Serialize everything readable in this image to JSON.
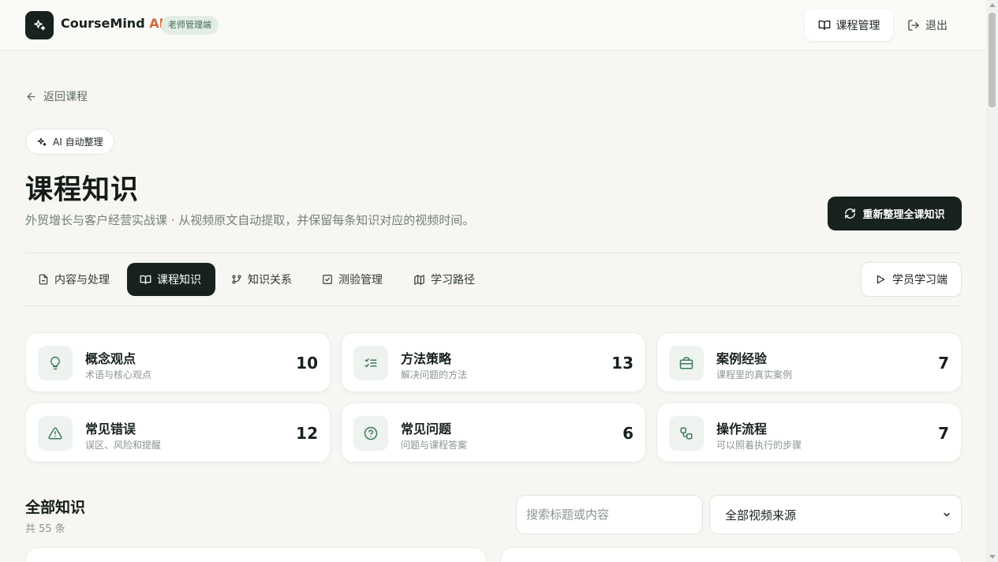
{
  "header": {
    "brand_name": "CourseMind",
    "brand_ai": "AI",
    "role_badge": "老师管理端",
    "course_mgmt_label": "课程管理",
    "logout_label": "退出"
  },
  "back_link": "返回课程",
  "ai_chip": "AI 自动整理",
  "page": {
    "title": "课程知识",
    "subtitle": "外贸增长与客户经营实战课 · 从视频原文自动提取，并保留每条知识对应的视频时间。",
    "reorganize_label": "重新整理全课知识"
  },
  "tabs": [
    {
      "label": "内容与处理",
      "icon": "file-icon"
    },
    {
      "label": "课程知识",
      "icon": "book-icon",
      "active": true
    },
    {
      "label": "知识关系",
      "icon": "git-branch-icon"
    },
    {
      "label": "测验管理",
      "icon": "check-square-icon"
    },
    {
      "label": "学习路径",
      "icon": "map-icon"
    }
  ],
  "student_button_label": "学员学习端",
  "categories": [
    {
      "title": "概念观点",
      "desc": "术语与核心观点",
      "count": "10",
      "icon": "lightbulb-icon"
    },
    {
      "title": "方法策略",
      "desc": "解决问题的方法",
      "count": "13",
      "icon": "list-check-icon"
    },
    {
      "title": "案例经验",
      "desc": "课程里的真实案例",
      "count": "7",
      "icon": "briefcase-icon"
    },
    {
      "title": "常见错误",
      "desc": "误区、风险和提醒",
      "count": "12",
      "icon": "warning-icon"
    },
    {
      "title": "常见问题",
      "desc": "问题与课程答案",
      "count": "6",
      "icon": "help-circle-icon"
    },
    {
      "title": "操作流程",
      "desc": "可以照着执行的步骤",
      "count": "7",
      "icon": "workflow-icon"
    }
  ],
  "knowledge": {
    "title": "全部知识",
    "count_label": "共 55 条",
    "search_placeholder": "搜索标题或内容",
    "source_select_value": "全部视频来源"
  },
  "colors": {
    "primary_dark": "#17211d",
    "accent_orange": "#d9643a",
    "icon_green": "#3f7a5c",
    "background": "#f7f6f2"
  }
}
